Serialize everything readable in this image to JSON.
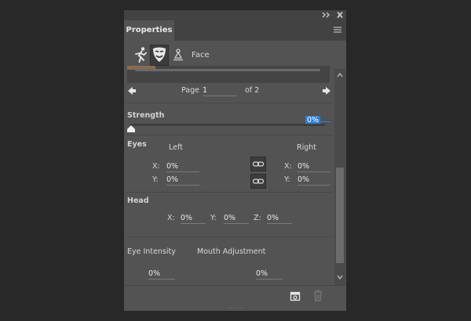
{
  "panel": {
    "tab_label": "Properties",
    "section_label": "Face"
  },
  "icons": {
    "double_chevron": "double-chevron-right-icon",
    "close": "close-icon",
    "menu": "hamburger-menu-icon",
    "body": "body-figure-icon",
    "face": "face-mask-icon",
    "tool": "puppet-pin-icon",
    "link": "link-chain-icon",
    "new": "new-preset-icon",
    "delete": "trash-icon"
  },
  "pager": {
    "page_label": "Page",
    "page_value": "1",
    "of_label": "of 2"
  },
  "strength": {
    "label": "Strength",
    "value": "0%",
    "level": 0
  },
  "eyes": {
    "label": "Eyes",
    "left_label": "Left",
    "right_label": "Right",
    "left_x_label": "X:",
    "left_x_value": "0%",
    "left_y_label": "Y:",
    "left_y_value": "0%",
    "right_x_label": "X:",
    "right_x_value": "0%",
    "right_y_label": "Y:",
    "right_y_value": "0%"
  },
  "head": {
    "label": "Head",
    "x_label": "X:",
    "x_value": "0%",
    "y_label": "Y:",
    "y_value": "0%",
    "z_label": "Z:",
    "z_value": "0%"
  },
  "bottom": {
    "eye_intensity_label": "Eye Intensity",
    "eye_intensity_value": "0%",
    "mouth_label": "Mouth Adjustment",
    "mouth_value": "0%"
  },
  "colors": {
    "panel_bg": "#535353",
    "app_bg": "#282828",
    "selection": "#2d7fd6"
  }
}
